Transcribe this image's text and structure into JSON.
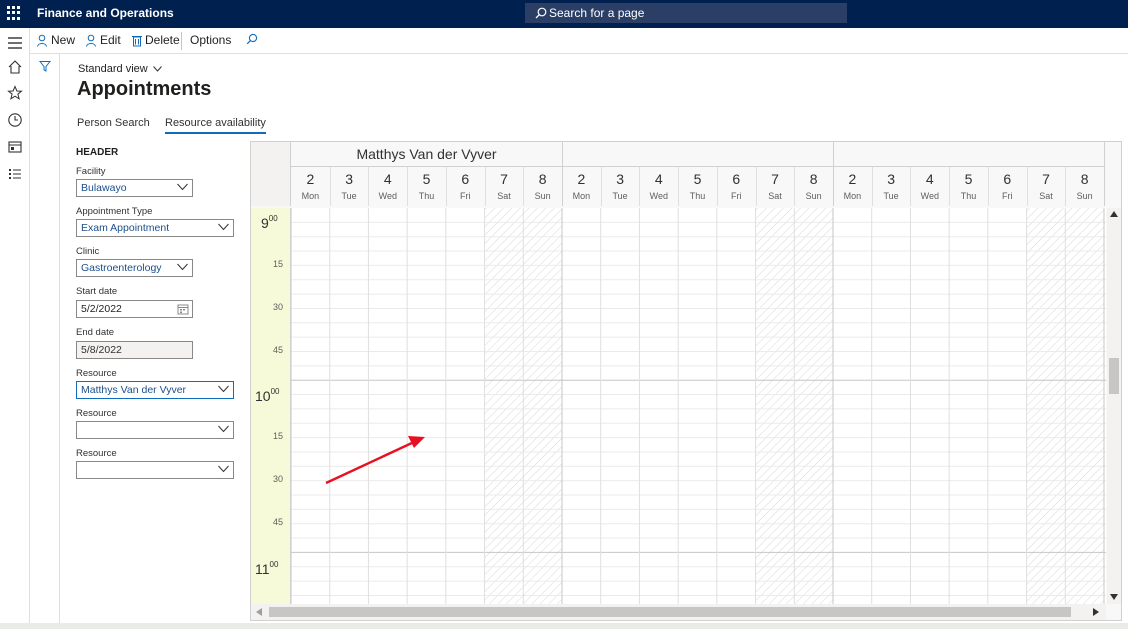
{
  "app": {
    "title": "Finance and Operations",
    "search_placeholder": "Search for a page"
  },
  "actions": {
    "new": "New",
    "edit": "Edit",
    "delete": "Delete",
    "options": "Options"
  },
  "page": {
    "view": "Standard view",
    "title": "Appointments"
  },
  "tabs": [
    {
      "label": "Person Search"
    },
    {
      "label": "Resource availability",
      "active": true
    }
  ],
  "header": {
    "section_label": "HEADER",
    "facility": {
      "label": "Facility",
      "value": "Bulawayo"
    },
    "appointment_type": {
      "label": "Appointment Type",
      "value": "Exam Appointment"
    },
    "clinic": {
      "label": "Clinic",
      "value": "Gastroenterology"
    },
    "start_date": {
      "label": "Start date",
      "value": "5/2/2022"
    },
    "end_date": {
      "label": "End date",
      "value": "5/8/2022"
    },
    "resource1": {
      "label": "Resource",
      "value": "Matthys Van der Vyver"
    },
    "resource2": {
      "label": "Resource",
      "value": ""
    },
    "resource3": {
      "label": "Resource",
      "value": ""
    }
  },
  "calendar": {
    "resources": [
      {
        "name": "Matthys Van der Vyver"
      },
      {
        "name": ""
      },
      {
        "name": ""
      }
    ],
    "days": [
      {
        "num": "2",
        "name": "Mon"
      },
      {
        "num": "3",
        "name": "Tue"
      },
      {
        "num": "4",
        "name": "Wed"
      },
      {
        "num": "5",
        "name": "Thu"
      },
      {
        "num": "6",
        "name": "Fri"
      },
      {
        "num": "7",
        "name": "Sat"
      },
      {
        "num": "8",
        "name": "Sun"
      }
    ],
    "hours": [
      {
        "h": "9",
        "m": "00",
        "q15": "15",
        "q30": "30",
        "q45": "45"
      },
      {
        "h": "10",
        "m": "00",
        "q15": "15",
        "q30": "30",
        "q45": "45"
      },
      {
        "h": "11",
        "m": "00"
      }
    ]
  },
  "colors": {
    "topbar": "#002050",
    "accent": "#0f6cbd",
    "time_column": "#f7fad9",
    "annotation_arrow": "#e81123"
  }
}
